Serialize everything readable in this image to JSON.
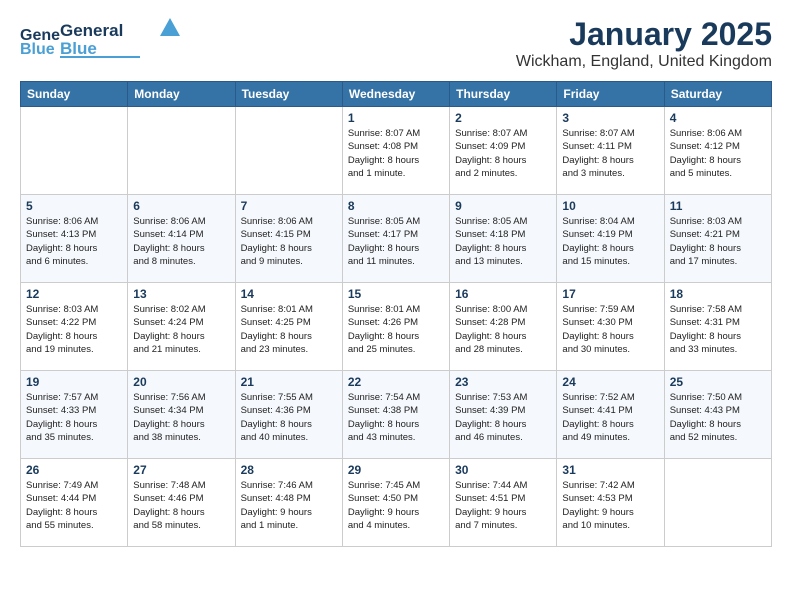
{
  "header": {
    "logo_general": "General",
    "logo_blue": "Blue",
    "month": "January 2025",
    "location": "Wickham, England, United Kingdom"
  },
  "weekdays": [
    "Sunday",
    "Monday",
    "Tuesday",
    "Wednesday",
    "Thursday",
    "Friday",
    "Saturday"
  ],
  "weeks": [
    [
      {
        "day": "",
        "info": ""
      },
      {
        "day": "",
        "info": ""
      },
      {
        "day": "",
        "info": ""
      },
      {
        "day": "1",
        "info": "Sunrise: 8:07 AM\nSunset: 4:08 PM\nDaylight: 8 hours\nand 1 minute."
      },
      {
        "day": "2",
        "info": "Sunrise: 8:07 AM\nSunset: 4:09 PM\nDaylight: 8 hours\nand 2 minutes."
      },
      {
        "day": "3",
        "info": "Sunrise: 8:07 AM\nSunset: 4:11 PM\nDaylight: 8 hours\nand 3 minutes."
      },
      {
        "day": "4",
        "info": "Sunrise: 8:06 AM\nSunset: 4:12 PM\nDaylight: 8 hours\nand 5 minutes."
      }
    ],
    [
      {
        "day": "5",
        "info": "Sunrise: 8:06 AM\nSunset: 4:13 PM\nDaylight: 8 hours\nand 6 minutes."
      },
      {
        "day": "6",
        "info": "Sunrise: 8:06 AM\nSunset: 4:14 PM\nDaylight: 8 hours\nand 8 minutes."
      },
      {
        "day": "7",
        "info": "Sunrise: 8:06 AM\nSunset: 4:15 PM\nDaylight: 8 hours\nand 9 minutes."
      },
      {
        "day": "8",
        "info": "Sunrise: 8:05 AM\nSunset: 4:17 PM\nDaylight: 8 hours\nand 11 minutes."
      },
      {
        "day": "9",
        "info": "Sunrise: 8:05 AM\nSunset: 4:18 PM\nDaylight: 8 hours\nand 13 minutes."
      },
      {
        "day": "10",
        "info": "Sunrise: 8:04 AM\nSunset: 4:19 PM\nDaylight: 8 hours\nand 15 minutes."
      },
      {
        "day": "11",
        "info": "Sunrise: 8:03 AM\nSunset: 4:21 PM\nDaylight: 8 hours\nand 17 minutes."
      }
    ],
    [
      {
        "day": "12",
        "info": "Sunrise: 8:03 AM\nSunset: 4:22 PM\nDaylight: 8 hours\nand 19 minutes."
      },
      {
        "day": "13",
        "info": "Sunrise: 8:02 AM\nSunset: 4:24 PM\nDaylight: 8 hours\nand 21 minutes."
      },
      {
        "day": "14",
        "info": "Sunrise: 8:01 AM\nSunset: 4:25 PM\nDaylight: 8 hours\nand 23 minutes."
      },
      {
        "day": "15",
        "info": "Sunrise: 8:01 AM\nSunset: 4:26 PM\nDaylight: 8 hours\nand 25 minutes."
      },
      {
        "day": "16",
        "info": "Sunrise: 8:00 AM\nSunset: 4:28 PM\nDaylight: 8 hours\nand 28 minutes."
      },
      {
        "day": "17",
        "info": "Sunrise: 7:59 AM\nSunset: 4:30 PM\nDaylight: 8 hours\nand 30 minutes."
      },
      {
        "day": "18",
        "info": "Sunrise: 7:58 AM\nSunset: 4:31 PM\nDaylight: 8 hours\nand 33 minutes."
      }
    ],
    [
      {
        "day": "19",
        "info": "Sunrise: 7:57 AM\nSunset: 4:33 PM\nDaylight: 8 hours\nand 35 minutes."
      },
      {
        "day": "20",
        "info": "Sunrise: 7:56 AM\nSunset: 4:34 PM\nDaylight: 8 hours\nand 38 minutes."
      },
      {
        "day": "21",
        "info": "Sunrise: 7:55 AM\nSunset: 4:36 PM\nDaylight: 8 hours\nand 40 minutes."
      },
      {
        "day": "22",
        "info": "Sunrise: 7:54 AM\nSunset: 4:38 PM\nDaylight: 8 hours\nand 43 minutes."
      },
      {
        "day": "23",
        "info": "Sunrise: 7:53 AM\nSunset: 4:39 PM\nDaylight: 8 hours\nand 46 minutes."
      },
      {
        "day": "24",
        "info": "Sunrise: 7:52 AM\nSunset: 4:41 PM\nDaylight: 8 hours\nand 49 minutes."
      },
      {
        "day": "25",
        "info": "Sunrise: 7:50 AM\nSunset: 4:43 PM\nDaylight: 8 hours\nand 52 minutes."
      }
    ],
    [
      {
        "day": "26",
        "info": "Sunrise: 7:49 AM\nSunset: 4:44 PM\nDaylight: 8 hours\nand 55 minutes."
      },
      {
        "day": "27",
        "info": "Sunrise: 7:48 AM\nSunset: 4:46 PM\nDaylight: 8 hours\nand 58 minutes."
      },
      {
        "day": "28",
        "info": "Sunrise: 7:46 AM\nSunset: 4:48 PM\nDaylight: 9 hours\nand 1 minute."
      },
      {
        "day": "29",
        "info": "Sunrise: 7:45 AM\nSunset: 4:50 PM\nDaylight: 9 hours\nand 4 minutes."
      },
      {
        "day": "30",
        "info": "Sunrise: 7:44 AM\nSunset: 4:51 PM\nDaylight: 9 hours\nand 7 minutes."
      },
      {
        "day": "31",
        "info": "Sunrise: 7:42 AM\nSunset: 4:53 PM\nDaylight: 9 hours\nand 10 minutes."
      },
      {
        "day": "",
        "info": ""
      }
    ]
  ]
}
